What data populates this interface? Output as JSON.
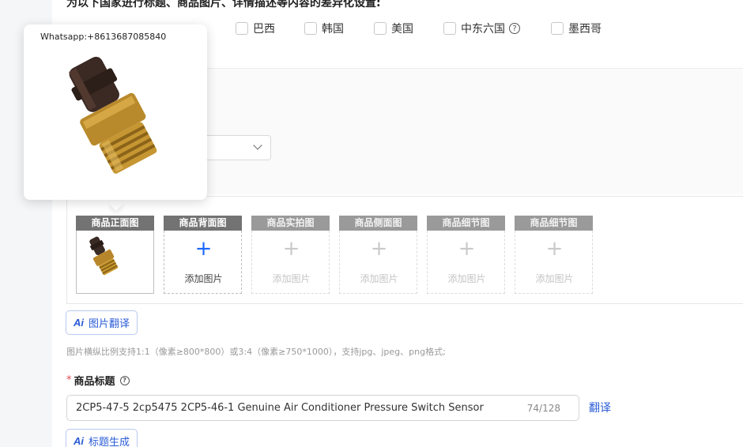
{
  "section": {
    "heading": "为以下国家进行标题、商品图片、详情描述等内容的差异化设置:",
    "countries": [
      {
        "label": "巴西"
      },
      {
        "label": "韩国"
      },
      {
        "label": "美国"
      },
      {
        "label": "中东六国",
        "help": "?"
      },
      {
        "label": "墨西哥"
      }
    ]
  },
  "popover": {
    "whatsapp": "Whatsapp:+8613687085840"
  },
  "images": {
    "slots": [
      {
        "label": "商品正面图",
        "filled": true
      },
      {
        "label": "商品背面图",
        "add": "添加图片",
        "active": true
      },
      {
        "label": "商品实拍图",
        "add": "添加图片"
      },
      {
        "label": "商品侧面图",
        "add": "添加图片"
      },
      {
        "label": "商品细节图",
        "add": "添加图片"
      },
      {
        "label": "商品细节图",
        "add": "添加图片"
      }
    ],
    "translate_button": {
      "ai": "Ai",
      "label": "图片翻译"
    },
    "hint": "图片横纵比例支持1:1（像素≥800*800）或3:4（像素≥750*1000），支持jpg、jpeg、png格式;"
  },
  "title_field": {
    "required_mark": "*",
    "label": "商品标题",
    "help": "?",
    "value": "2CP5-47-5 2cp5475 2CP5-46-1 Genuine Air Conditioner Pressure Switch Sensor",
    "counter": "74/128",
    "translate": "翻译",
    "generate_button": {
      "ai": "Ai",
      "label": "标题生成"
    }
  },
  "icons": {
    "plus": "+",
    "help": "question-circle-icon",
    "chevron": "chevron-down-icon"
  },
  "colors": {
    "accent": "#2a5bd7",
    "required": "#e5484d",
    "slot_header": "#737373"
  }
}
